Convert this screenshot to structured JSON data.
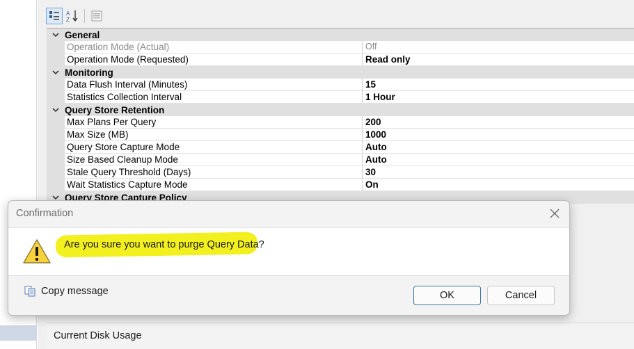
{
  "toolbar": {
    "categorized_icon": "categorized-icon",
    "alphabetical_icon": "sort-az-icon",
    "property_pages_icon": "property-pages-icon"
  },
  "properties": {
    "categories": [
      {
        "name": "General",
        "rows": [
          {
            "label": "Operation Mode (Actual)",
            "value": "Off",
            "disabled": true
          },
          {
            "label": "Operation Mode (Requested)",
            "value": "Read only"
          }
        ]
      },
      {
        "name": "Monitoring",
        "rows": [
          {
            "label": "Data Flush Interval (Minutes)",
            "value": "15"
          },
          {
            "label": "Statistics Collection Interval",
            "value": "1 Hour"
          }
        ]
      },
      {
        "name": "Query Store Retention",
        "rows": [
          {
            "label": "Max Plans Per Query",
            "value": "200"
          },
          {
            "label": "Max Size (MB)",
            "value": "1000"
          },
          {
            "label": "Query Store Capture Mode",
            "value": "Auto"
          },
          {
            "label": "Size Based Cleanup Mode",
            "value": "Auto"
          },
          {
            "label": "Stale Query Threshold (Days)",
            "value": "30"
          },
          {
            "label": "Wait Statistics Capture Mode",
            "value": "On"
          }
        ]
      },
      {
        "name": "Query Store Capture Policy",
        "rows": []
      }
    ]
  },
  "disk_usage": {
    "label": "Current Disk Usage"
  },
  "dialog": {
    "title": "Confirmation",
    "message": "Are you sure you want to purge Query Data?",
    "copy_label": "Copy message",
    "ok_label": "OK",
    "cancel_label": "Cancel",
    "highlight_color": "#f3f01f",
    "icon": "warning-icon"
  }
}
